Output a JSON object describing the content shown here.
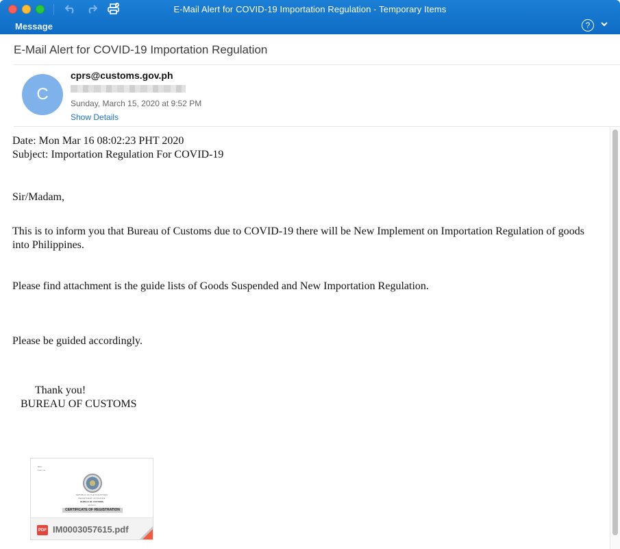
{
  "window": {
    "title": "E-Mail Alert for COVID-19 Importation Regulation - Temporary Items",
    "ribbon_tab": "Message",
    "icons": [
      "close",
      "minimize",
      "maximize",
      "undo-icon",
      "redo-icon",
      "print-icon",
      "help-icon",
      "chevron-down-icon"
    ],
    "help_glyph": "?",
    "chevron_glyph": "⌄"
  },
  "message": {
    "subject": "E-Mail Alert for COVID-19 Importation Regulation",
    "avatar_initial": "C",
    "avatar_color": "#7fb2ea",
    "sender": "cprs@customs.gov.ph",
    "date": "Sunday, March 15, 2020 at 9:52 PM",
    "show_details": "Show Details"
  },
  "body": {
    "date_line": "Date: Mon Mar 16 08:02:23 PHT 2020",
    "subject_line": "Subject: Importation Regulation For COVID-19",
    "greeting": "Sir/Madam,",
    "para1": "This is to inform you that Bureau of Customs due to COVID-19 there will be New Implement on Importation Regulation of goods into Philippines.",
    "para2": "Please find attachment is the guide lists of Goods Suspended and New Importation Regulation.",
    "para3": "Please be guided accordingly.",
    "thanks": "Thank you!",
    "signature": "BUREAU OF CUSTOMS"
  },
  "attachment": {
    "filename": "IM0003057615.pdf",
    "type_badge": "PDF",
    "preview": {
      "corner_text1": "BOC",
      "corner_text2": "Form no.",
      "lines": [
        "REPUBLIC OF THE PHILIPPINES",
        "DEPARTMENT OF FINANCE",
        "BUREAU OF CUSTOMS",
        "MANILA"
      ],
      "banner": "CERTIFICATE OF REGISTRATION"
    }
  }
}
